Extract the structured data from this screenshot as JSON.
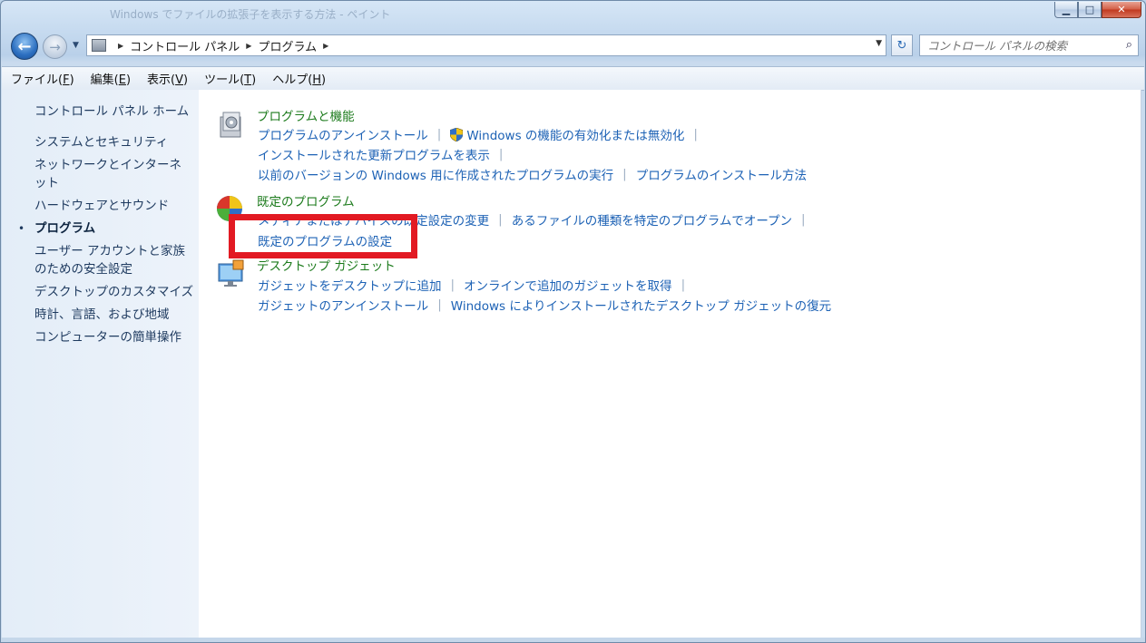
{
  "window": {
    "title": "Windows でファイルの拡張子を表示する方法 - ペイント",
    "controls": {
      "minimize": "▁",
      "maximize": "□",
      "close": "✕"
    }
  },
  "nav": {
    "back_glyph": "←",
    "forward_glyph": "→",
    "recent_glyph": "▼",
    "refresh_glyph": "↻",
    "address": {
      "crumbs": [
        "コントロール パネル",
        "プログラム"
      ],
      "separator": "▶",
      "dropdown_glyph": "▼"
    },
    "search": {
      "placeholder": "コントロール パネルの検索",
      "icon_glyph": "⌕"
    }
  },
  "menubar": [
    {
      "label": "ファイル(",
      "key": "F",
      "end": ")"
    },
    {
      "label": "編集(",
      "key": "E",
      "end": ")"
    },
    {
      "label": "表示(",
      "key": "V",
      "end": ")"
    },
    {
      "label": "ツール(",
      "key": "T",
      "end": ")"
    },
    {
      "label": "ヘルプ(",
      "key": "H",
      "end": ")"
    }
  ],
  "sidebar": {
    "home": "コントロール パネル ホーム",
    "bullet": "•",
    "items": [
      "システムとセキュリティ",
      "ネットワークとインターネット",
      "ハードウェアとサウンド",
      "プログラム",
      "ユーザー アカウントと家族のための安全設定",
      "デスクトップのカスタマイズ",
      "時計、言語、および地域",
      "コンピューターの簡単操作"
    ]
  },
  "categories": {
    "programs_features": {
      "title": "プログラムと機能",
      "links": {
        "uninstall": "プログラムのアンインストール",
        "windows_features": "Windows の機能の有効化または無効化",
        "installed_updates": "インストールされた更新プログラムを表示",
        "compat": "以前のバージョンの Windows 用に作成されたプログラムの実行",
        "how_install": "プログラムのインストール方法"
      }
    },
    "default_programs": {
      "title": "既定のプログラム",
      "links": {
        "media_autoplay": "メディアまたはデバイスの既定設定の変更",
        "file_type": "あるファイルの種類を特定のプログラムでオープン",
        "set_defaults": "既定のプログラムの設定"
      }
    },
    "gadgets": {
      "title": "デスクトップ ガジェット",
      "links": {
        "add": "ガジェットをデスクトップに追加",
        "online": "オンラインで追加のガジェットを取得",
        "uninstall": "ガジェットのアンインストール",
        "restore": "Windows によりインストールされたデスクトップ ガジェットの復元"
      }
    }
  },
  "separator": "|",
  "colors": {
    "category_title": "#1b7a1b",
    "link": "#1d62b5",
    "highlight": "#e21a23"
  }
}
